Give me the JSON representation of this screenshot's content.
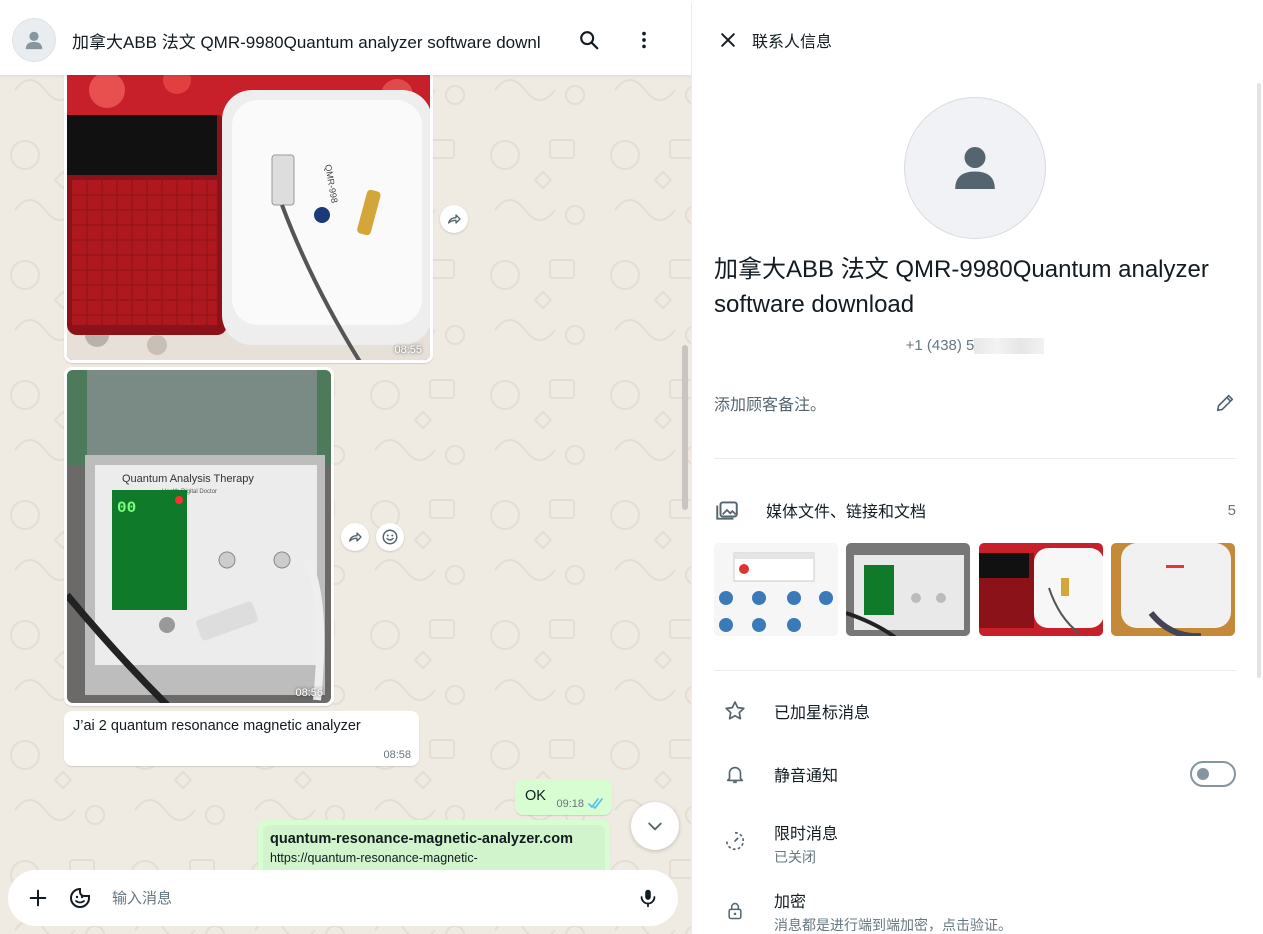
{
  "chat": {
    "title": "加拿大ABB 法文 QMR-9980Quantum analyzer software downl",
    "messages": {
      "image1_time": "08:55",
      "image2_time": "08:56",
      "text_in": "J’ai 2 quantum resonance magnetic analyzer",
      "text_in_time": "08:58",
      "text_out": "OK",
      "text_out_time": "09:18",
      "link_title": "quantum-resonance-magnetic-analyzer.com",
      "link_url": "https://quantum-resonance-magnetic-"
    },
    "image2_screen_text": "Quantum Analysis Therapy",
    "image2_screen_sub": "Health Digital Doctor",
    "image2_digits": "00",
    "image1_device_label": "QMR-998"
  },
  "composer": {
    "placeholder": "输入消息"
  },
  "info": {
    "header_title": "联系人信息",
    "contact_name": "加拿大ABB 法文 QMR-9980Quantum analyzer software download",
    "phone": "+1 (438) 5",
    "note_placeholder": "添加顾客备注。",
    "media_label": "媒体文件、链接和文档",
    "media_count": "5",
    "starred_label": "已加星标消息",
    "mute_label": "静音通知",
    "disappearing_label": "限时消息",
    "disappearing_status": "已关闭",
    "encryption_label": "加密",
    "encryption_desc": "消息都是进行端到端加密，点击验证。"
  },
  "colors": {
    "accent_tick": "#53bdeb",
    "outgoing_bubble": "#d9fdd3",
    "chat_bg": "#efeae2"
  },
  "icons": [
    "person-icon",
    "search-icon",
    "kebab-menu-icon",
    "forward-icon",
    "emoji-react-icon",
    "chevron-down-icon",
    "plus-icon",
    "sticker-icon",
    "mic-icon",
    "close-icon",
    "pencil-icon",
    "media-gallery-icon",
    "star-icon",
    "bell-icon",
    "timer-icon",
    "lock-icon"
  ]
}
